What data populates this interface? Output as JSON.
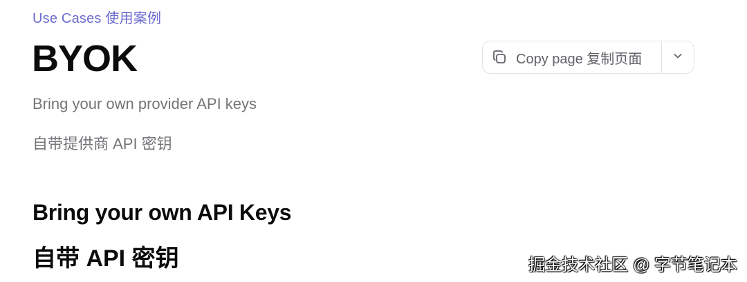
{
  "breadcrumb": "Use Cases  使用案例",
  "title": "BYOK",
  "copy_page": {
    "label": "Copy page  复制页面",
    "icon": "copy-icon",
    "dropdown_icon": "chevron-down-icon"
  },
  "subtitle": "Bring your own provider API keys",
  "subtitle_cn": "自带提供商 API 密钥",
  "section": {
    "heading": "Bring your own API Keys",
    "heading_cn": "自带 API 密钥"
  },
  "watermark": "掘金技术社区 @ 字节笔记本",
  "colors": {
    "accent": "#6b6ad0",
    "text_muted": "#747479",
    "border": "#e3e3e6"
  }
}
